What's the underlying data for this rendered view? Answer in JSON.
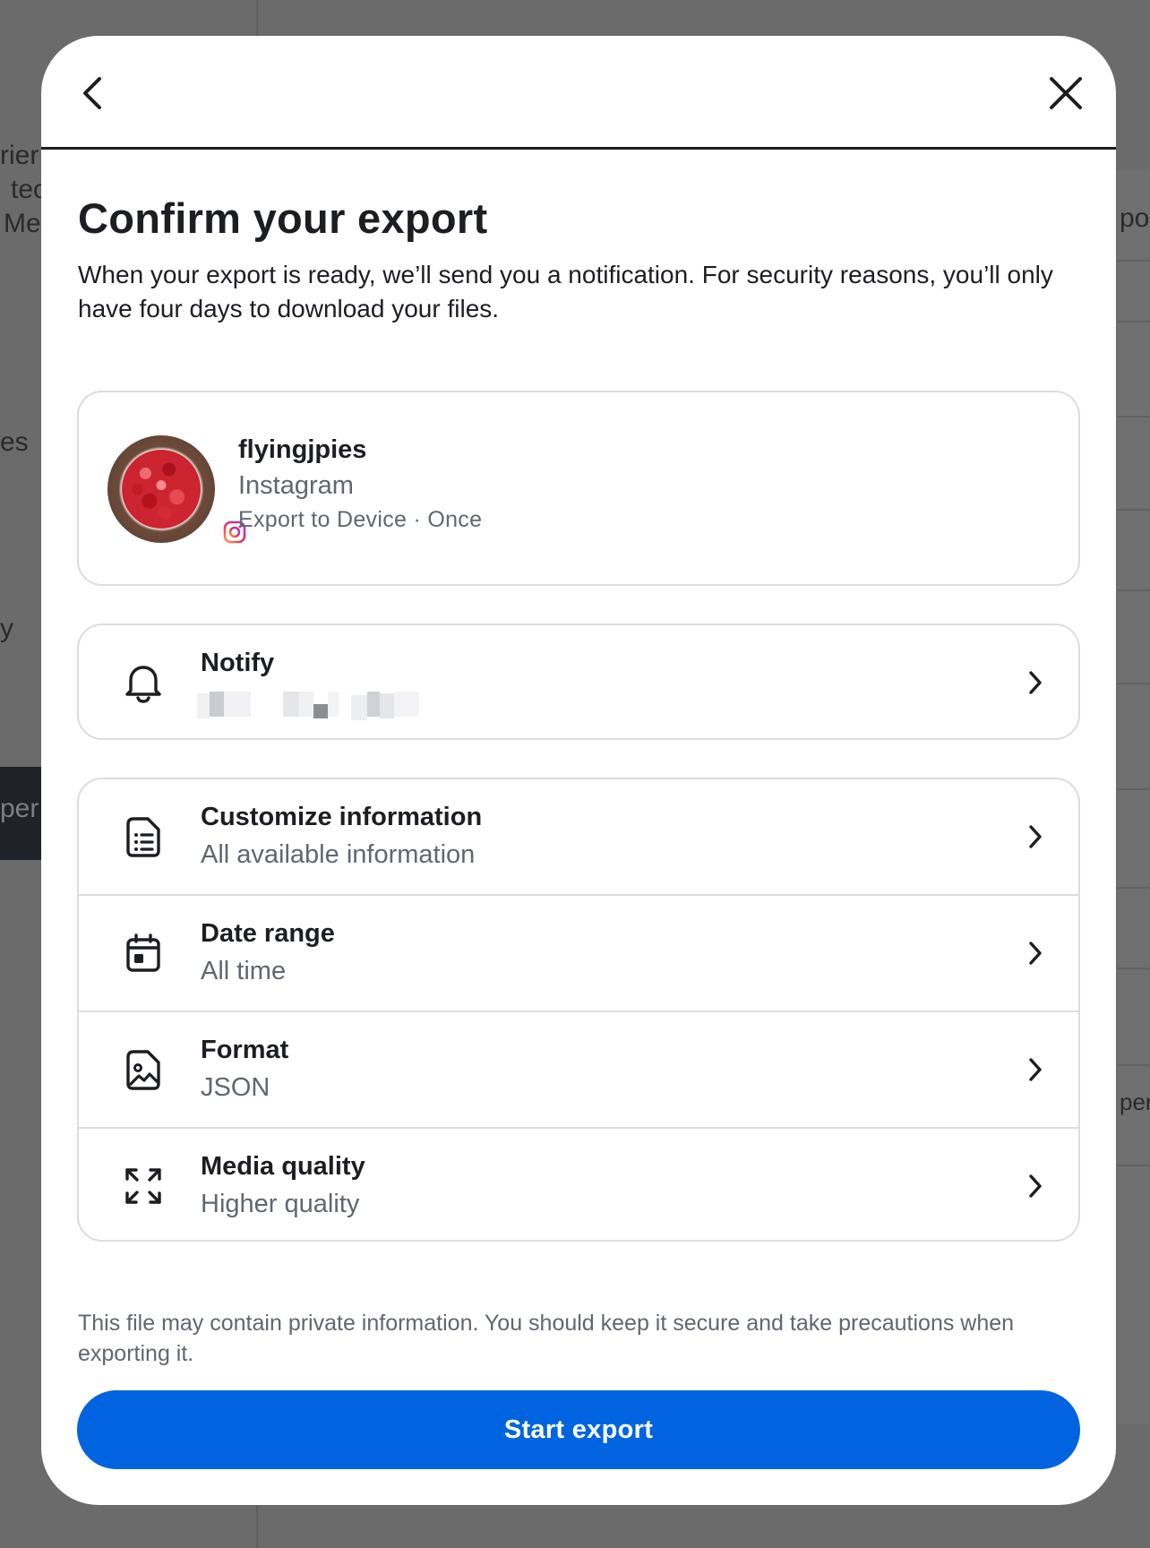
{
  "background": {
    "fragments": [
      "rier",
      "tec",
      "Me",
      "es",
      "y",
      "per",
      "po",
      "per"
    ]
  },
  "header": {
    "back_icon": "chevron-left-icon",
    "close_icon": "close-icon"
  },
  "title": "Confirm your export",
  "description": "When your export is ready, we’ll send you a notification. For security reasons, you’ll only have four days to download your files.",
  "account": {
    "username": "flyingjpies",
    "platform": "Instagram",
    "meta": "Export to Device · Once",
    "badge_icon": "instagram-icon"
  },
  "notify": {
    "title": "Notify",
    "icon": "bell-icon",
    "value_redacted": true
  },
  "settings": [
    {
      "title": "Customize information",
      "value": "All available information",
      "icon": "document-list-icon"
    },
    {
      "title": "Date range",
      "value": "All time",
      "icon": "calendar-icon"
    },
    {
      "title": "Format",
      "value": "JSON",
      "icon": "image-file-icon"
    },
    {
      "title": "Media quality",
      "value": "Higher quality",
      "icon": "expand-icon"
    }
  ],
  "disclaimer": "This file may contain private information. You should keep it secure and take precautions when exporting it.",
  "primary_button": "Start export",
  "colors": {
    "primary": "#0064e0",
    "text": "#1c1e21",
    "secondary_text": "#606770",
    "border": "#dadde1",
    "overlay": "#6b6b6b"
  }
}
